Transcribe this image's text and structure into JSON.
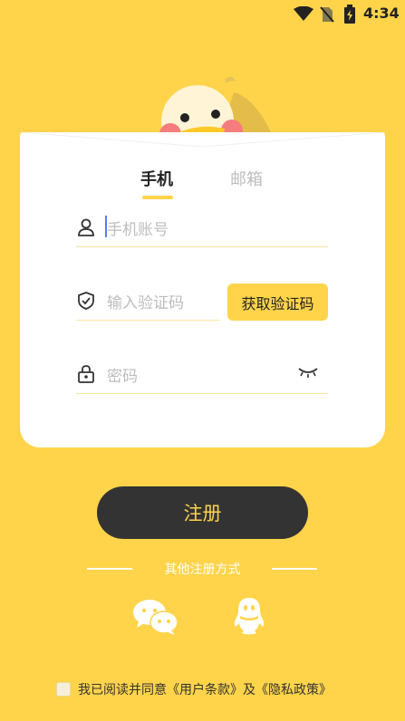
{
  "status_bar": {
    "time": "4:34"
  },
  "tabs": {
    "phone": "手机",
    "email": "邮箱"
  },
  "form": {
    "phone_placeholder": "手机账号",
    "code_placeholder": "输入验证码",
    "get_code_label": "获取验证码",
    "password_placeholder": "密码"
  },
  "register": {
    "label": "注册"
  },
  "other": {
    "title": "其他注册方式"
  },
  "agreement": {
    "prefix": "我已阅读并同意",
    "terms": "《用户条款》",
    "and": "及",
    "privacy": "《隐私政策》"
  },
  "colors": {
    "background": "#FFD44A",
    "button_dark": "#333333",
    "accent": "#FFD44A"
  }
}
